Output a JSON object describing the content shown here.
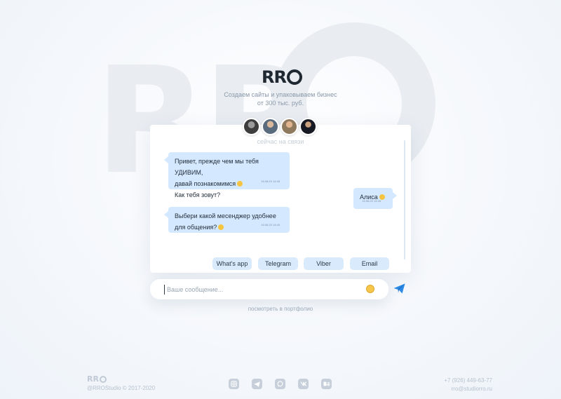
{
  "brand": {
    "logo_text": "RRO",
    "tagline_line1": "Создаем сайты и упаковываем бизнес",
    "tagline_line2": "от 300 тыс. руб."
  },
  "chat": {
    "status": "сейчас на связи",
    "messages": [
      {
        "side": "incoming",
        "lines": [
          "Привет, прежде чем мы тебя УДИВИМ,",
          "давай познакомимся",
          "Как тебя зовут?"
        ],
        "time": "15.06.20 14:45"
      },
      {
        "side": "outgoing",
        "lines": [
          "Алиса"
        ],
        "time": "15.06.20 14:45"
      },
      {
        "side": "incoming",
        "lines": [
          "Выбери какой месенджер удобнее",
          "для общения?"
        ],
        "time": "15.06.20 14:45"
      }
    ],
    "messenger_options": [
      "What's app",
      "Telegram",
      "Viber",
      "Email"
    ]
  },
  "input": {
    "placeholder": "Ваше сообщение..."
  },
  "portfolio_link": "посмотреть в портфолио",
  "footer": {
    "logo_text": "RRO",
    "copyright": "@RROStudio  © 2017-2020",
    "social_icons": [
      "instagram-icon",
      "telegram-icon",
      "whatsapp-icon",
      "vk-icon",
      "behance-icon"
    ],
    "phone": "+7 (926) 449-63-77",
    "email": "rro@studiorro.ru"
  },
  "colors": {
    "accent": "#2b8ae6",
    "bubble": "#d4e8ff",
    "button": "#d9eafc"
  }
}
